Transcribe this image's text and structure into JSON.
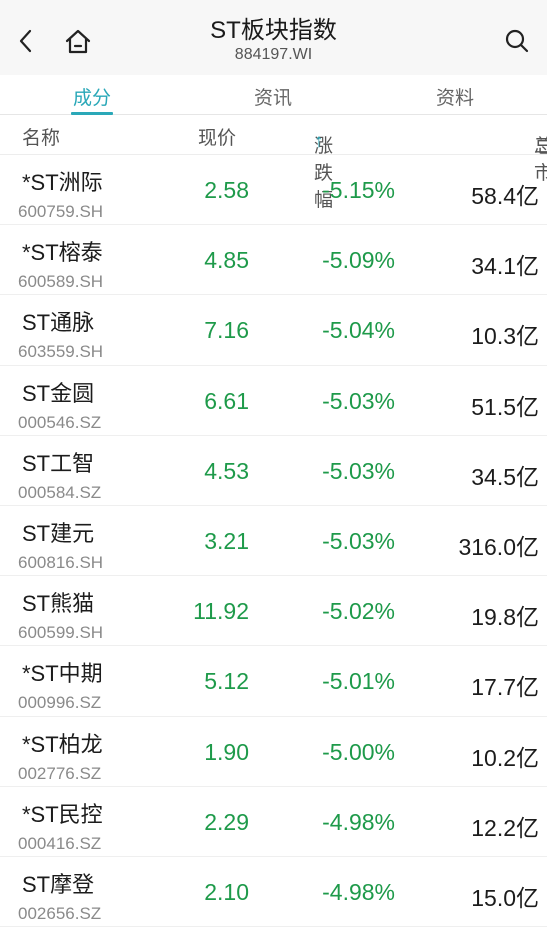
{
  "nav": {
    "title": "ST板块指数",
    "subtitle": "884197.WI"
  },
  "tabs": [
    {
      "label": "成分"
    },
    {
      "label": "资讯"
    },
    {
      "label": "资料"
    }
  ],
  "columns": {
    "name": "名称",
    "price": "现价",
    "change": "涨跌幅",
    "change_arrow": "↑",
    "cap": "总市",
    "menu_icon": "三"
  },
  "colors": {
    "accent": "#2aa8b8",
    "down": "#1e9a4a"
  },
  "stocks": [
    {
      "name": "*ST洲际",
      "code": "600759.SH",
      "price": "2.58",
      "change": "-5.15%",
      "cap": "58.4亿"
    },
    {
      "name": "*ST榕泰",
      "code": "600589.SH",
      "price": "4.85",
      "change": "-5.09%",
      "cap": "34.1亿"
    },
    {
      "name": "ST通脉",
      "code": "603559.SH",
      "price": "7.16",
      "change": "-5.04%",
      "cap": "10.3亿"
    },
    {
      "name": "ST金圆",
      "code": "000546.SZ",
      "price": "6.61",
      "change": "-5.03%",
      "cap": "51.5亿"
    },
    {
      "name": "ST工智",
      "code": "000584.SZ",
      "price": "4.53",
      "change": "-5.03%",
      "cap": "34.5亿"
    },
    {
      "name": "ST建元",
      "code": "600816.SH",
      "price": "3.21",
      "change": "-5.03%",
      "cap": "316.0亿"
    },
    {
      "name": "ST熊猫",
      "code": "600599.SH",
      "price": "11.92",
      "change": "-5.02%",
      "cap": "19.8亿"
    },
    {
      "name": "*ST中期",
      "code": "000996.SZ",
      "price": "5.12",
      "change": "-5.01%",
      "cap": "17.7亿"
    },
    {
      "name": "*ST柏龙",
      "code": "002776.SZ",
      "price": "1.90",
      "change": "-5.00%",
      "cap": "10.2亿"
    },
    {
      "name": "*ST民控",
      "code": "000416.SZ",
      "price": "2.29",
      "change": "-4.98%",
      "cap": "12.2亿"
    },
    {
      "name": "ST摩登",
      "code": "002656.SZ",
      "price": "2.10",
      "change": "-4.98%",
      "cap": "15.0亿"
    }
  ]
}
